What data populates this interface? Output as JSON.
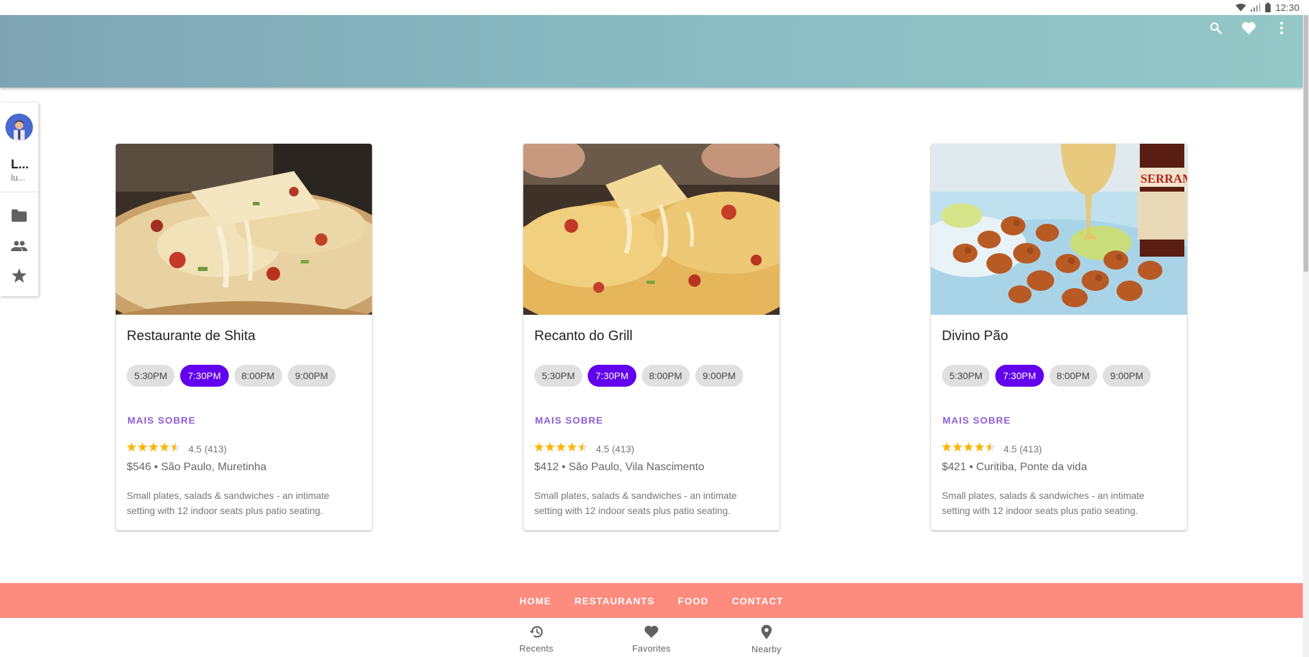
{
  "status_bar": {
    "time": "12:30",
    "icons": [
      "wifi-icon",
      "signal-icon",
      "battery-icon"
    ]
  },
  "app_bar": {
    "actions": [
      "search-icon",
      "heart-icon",
      "more-vert-icon"
    ]
  },
  "drawer": {
    "name": "L...",
    "email": "lu...",
    "items": [
      {
        "icon": "folder-icon"
      },
      {
        "icon": "people-icon"
      },
      {
        "icon": "star-icon"
      }
    ]
  },
  "cards": [
    {
      "title": "Restaurante de Shita",
      "times": [
        "5:30PM",
        "7:30PM",
        "8:00PM",
        "9:00PM"
      ],
      "selected_time": "7:30PM",
      "more_label": "MAIS SOBRE",
      "rating": 4.5,
      "rating_text": "4.5 (413)",
      "price_location": "$546 • São Paulo, Muretinha",
      "description": "Small plates, salads & sandwiches - an intimate setting with 12 indoor seats plus patio seating."
    },
    {
      "title": "Recanto do Grill",
      "times": [
        "5:30PM",
        "7:30PM",
        "8:00PM",
        "9:00PM"
      ],
      "selected_time": "7:30PM",
      "more_label": "MAIS SOBRE",
      "rating": 4.5,
      "rating_text": "4.5 (413)",
      "price_location": "$412 • São Paulo, Vila Nascimento",
      "description": "Small plates, salads & sandwiches - an intimate setting with 12 indoor seats plus patio seating."
    },
    {
      "title": "Divino Pão",
      "times": [
        "5:30PM",
        "7:30PM",
        "8:00PM",
        "9:00PM"
      ],
      "selected_time": "7:30PM",
      "more_label": "MAIS SOBRE",
      "rating": 4.5,
      "rating_text": "4.5 (413)",
      "price_location": "$421 • Curitiba, Ponte da vida",
      "description": "Small plates, salads & sandwiches - an intimate setting with 12 indoor seats plus patio seating."
    }
  ],
  "footer_nav": [
    "HOME",
    "RESTAURANTS",
    "FOOD",
    "CONTACT"
  ],
  "bottom_nav": [
    {
      "label": "Recents",
      "icon": "history-icon"
    },
    {
      "label": "Favorites",
      "icon": "heart-icon"
    },
    {
      "label": "Nearby",
      "icon": "location-pin-icon"
    }
  ],
  "colors": {
    "primary": "#6200ee",
    "link": "#8e5fd6",
    "star": "#ffb400",
    "footer": "#fd8b7e",
    "appbar_start": "#7fa5b3",
    "appbar_end": "#94c8c7"
  }
}
